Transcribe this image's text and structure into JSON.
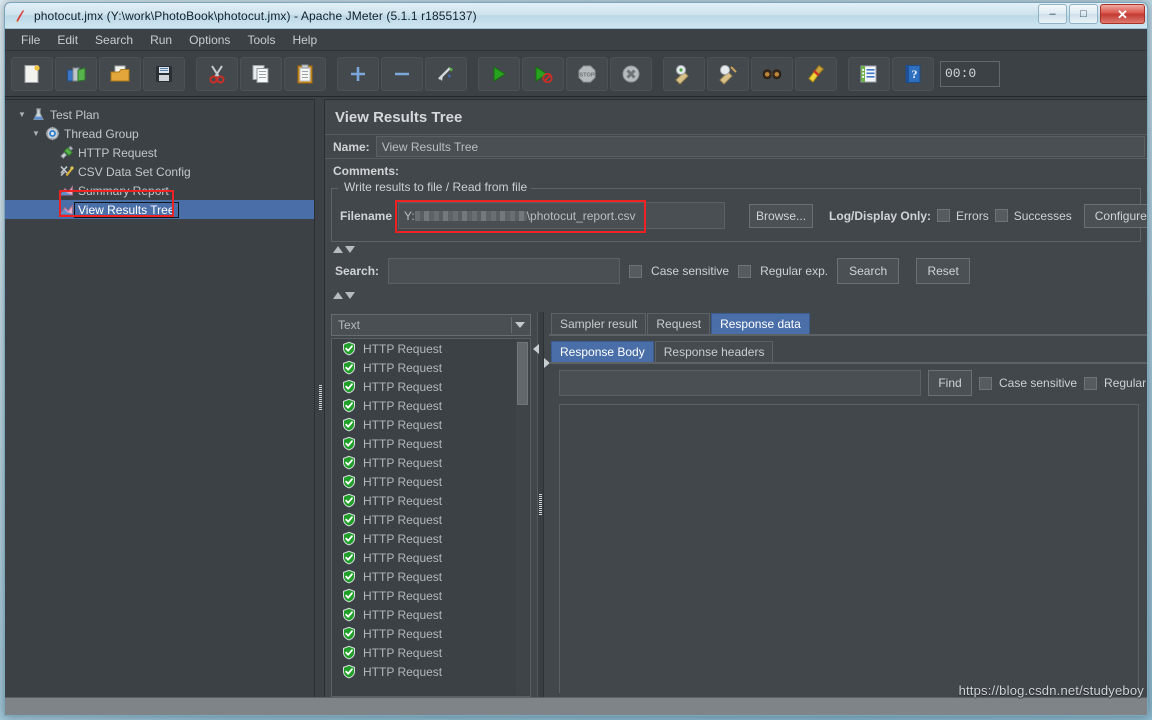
{
  "window": {
    "title": "photocut.jmx (Y:\\work\\PhotoBook\\photocut.jmx) - Apache JMeter (5.1.1 r1855137)",
    "app_icon": "jmeter-feather-icon",
    "minimize_label": "–",
    "maximize_label": "□",
    "close_label": "✕"
  },
  "menubar": {
    "items": [
      {
        "label": "File"
      },
      {
        "label": "Edit"
      },
      {
        "label": "Search"
      },
      {
        "label": "Run"
      },
      {
        "label": "Options"
      },
      {
        "label": "Tools"
      },
      {
        "label": "Help"
      }
    ]
  },
  "toolbar": {
    "buttons": [
      {
        "name": "new-test-plan-icon",
        "title": "New"
      },
      {
        "name": "templates-icon",
        "title": "Templates"
      },
      {
        "name": "open-icon",
        "title": "Open"
      },
      {
        "name": "save-icon",
        "title": "Save"
      },
      {
        "name": "cut-icon",
        "title": "Cut"
      },
      {
        "name": "copy-icon",
        "title": "Copy"
      },
      {
        "name": "paste-icon",
        "title": "Paste"
      },
      {
        "name": "expand-all-icon",
        "title": "Expand all"
      },
      {
        "name": "collapse-all-icon",
        "title": "Collapse all"
      },
      {
        "name": "toggle-icon",
        "title": "Toggle"
      },
      {
        "name": "start-icon",
        "title": "Start"
      },
      {
        "name": "start-no-pauses-icon",
        "title": "Start no pauses"
      },
      {
        "name": "stop-icon",
        "title": "Stop"
      },
      {
        "name": "shutdown-icon",
        "title": "Shutdown"
      },
      {
        "name": "clear-icon",
        "title": "Clear"
      },
      {
        "name": "clear-all-icon",
        "title": "Clear All"
      },
      {
        "name": "search-icon",
        "title": "Search"
      },
      {
        "name": "reset-search-icon",
        "title": "Reset Search"
      },
      {
        "name": "function-helper-icon",
        "title": "Function Helper Dialog"
      },
      {
        "name": "help-icon",
        "title": "Help"
      }
    ],
    "timer_value": "00:0"
  },
  "tree": {
    "items": [
      {
        "label": "Test Plan",
        "icon": "test-plan-icon",
        "depth": 0,
        "twisty": "▼",
        "selected": false
      },
      {
        "label": "Thread Group",
        "icon": "thread-group-icon",
        "depth": 1,
        "twisty": "▼",
        "selected": false
      },
      {
        "label": "HTTP Request",
        "icon": "http-request-icon",
        "depth": 2,
        "twisty": "",
        "selected": false
      },
      {
        "label": "CSV Data Set Config",
        "icon": "csv-config-icon",
        "depth": 2,
        "twisty": "",
        "selected": false
      },
      {
        "label": "Summary Report",
        "icon": "summary-report-icon",
        "depth": 2,
        "twisty": "",
        "selected": false
      },
      {
        "label": "View Results Tree",
        "icon": "results-tree-icon",
        "depth": 2,
        "twisty": "",
        "selected": true
      }
    ]
  },
  "panel": {
    "title": "View Results Tree",
    "name_label": "Name:",
    "name_value": "View Results Tree",
    "comments_label": "Comments:",
    "comments_value": "",
    "group_title": "Write results to file / Read from file",
    "filename_label": "Filename",
    "filename_value_prefix": "Y:",
    "filename_value_suffix": "\\photocut_report.csv",
    "browse_label": "Browse...",
    "log_display_label": "Log/Display Only:",
    "errors_label": "Errors",
    "successes_label": "Successes",
    "configure_label": "Configure",
    "search_label": "Search:",
    "search_value": "",
    "case_sensitive_label": "Case sensitive",
    "regular_exp_label": "Regular exp.",
    "search_button_label": "Search",
    "reset_button_label": "Reset"
  },
  "results": {
    "renderer_selected": "Text",
    "renderer_options": [
      "Text"
    ],
    "entries": [
      "HTTP Request",
      "HTTP Request",
      "HTTP Request",
      "HTTP Request",
      "HTTP Request",
      "HTTP Request",
      "HTTP Request",
      "HTTP Request",
      "HTTP Request",
      "HTTP Request",
      "HTTP Request",
      "HTTP Request",
      "HTTP Request",
      "HTTP Request",
      "HTTP Request",
      "HTTP Request",
      "HTTP Request",
      "HTTP Request"
    ],
    "entry_status_icon": "green-shield-success-icon"
  },
  "detail": {
    "tabs": [
      {
        "label": "Sampler result",
        "active": false
      },
      {
        "label": "Request",
        "active": false
      },
      {
        "label": "Response data",
        "active": true
      }
    ],
    "subtabs": [
      {
        "label": "Response Body",
        "active": true
      },
      {
        "label": "Response headers",
        "active": false
      }
    ],
    "find_value": "",
    "find_button_label": "Find",
    "case_sensitive_label": "Case sensitive",
    "regular_exp_label": "Regular",
    "response_body_text": ""
  },
  "watermark": {
    "text": "https://blog.csdn.net/studyeboy"
  },
  "colors": {
    "accent_selection": "#4a6fa8",
    "panel_bg": "#42474b",
    "window_bg": "#3c4145",
    "annotation": "#ee2222",
    "success_green": "#2aa52a"
  }
}
